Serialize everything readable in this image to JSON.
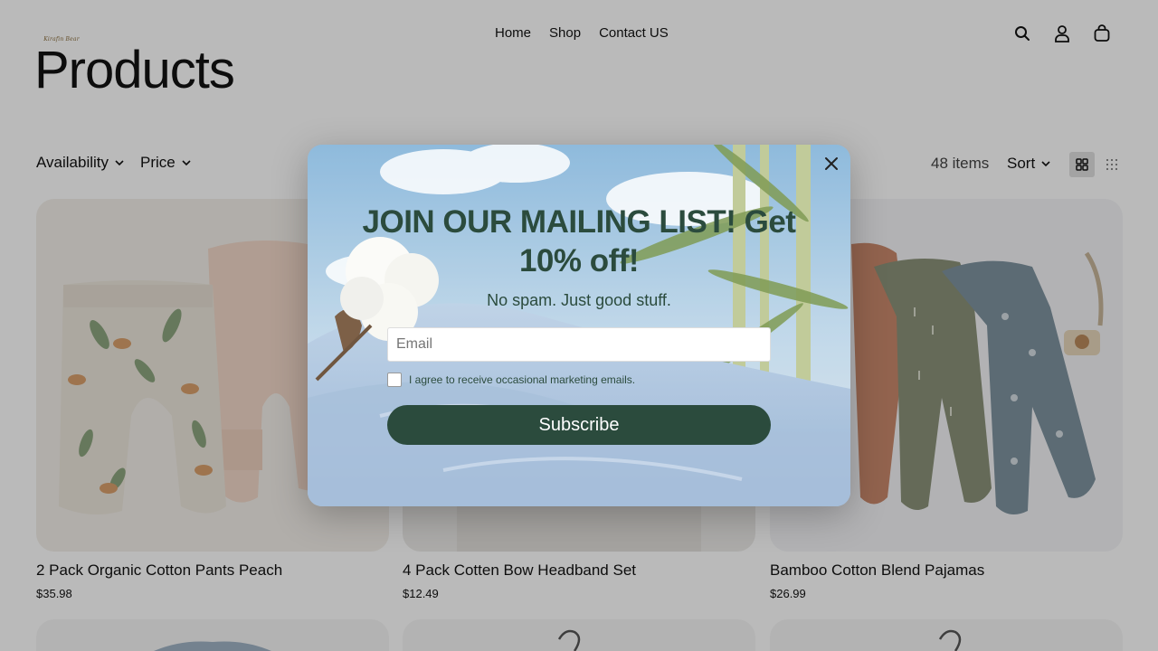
{
  "header": {
    "logo_text": "Kirafin Bear",
    "nav": [
      "Home",
      "Shop",
      "Contact US"
    ],
    "icons": [
      "search-icon",
      "account-icon",
      "cart-icon"
    ]
  },
  "page": {
    "title": "Products"
  },
  "filters": {
    "availability": "Availability",
    "price": "Price",
    "count": "48 items",
    "sort": "Sort"
  },
  "products": [
    {
      "title": "2 Pack Organic Cotton Pants Peach",
      "price": "$35.98"
    },
    {
      "title": "4 Pack Cotten Bow Headband Set",
      "price": "$12.49"
    },
    {
      "title": "Bamboo Cotton Blend Pajamas",
      "price": "$26.99"
    }
  ],
  "popup": {
    "title": "JOIN OUR MAILING LIST! Get 10% off!",
    "subtitle": "No spam. Just good stuff.",
    "email_placeholder": "Email",
    "consent": "I agree to receive occasional marketing emails.",
    "button": "Subscribe"
  },
  "colors": {
    "brand_green": "#2b4b3d",
    "overlay": "rgba(0,0,0,0.27)"
  }
}
